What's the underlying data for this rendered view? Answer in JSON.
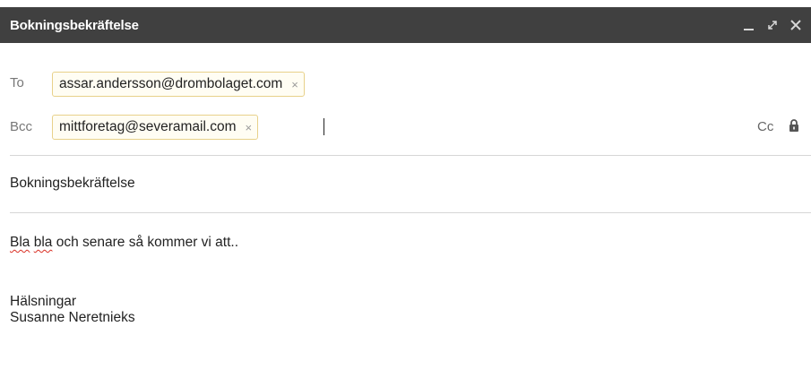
{
  "window": {
    "title": "Bokningsbekräftelse",
    "controls": [
      "minimize",
      "expand",
      "close"
    ]
  },
  "recipients": {
    "to": {
      "label": "To",
      "chips": [
        "assar.andersson@drombolaget.com"
      ]
    },
    "bcc": {
      "label": "Bcc",
      "chips": [
        "mittforetag@severamail.com"
      ]
    },
    "cc_link": "Cc"
  },
  "subject": "Bokningsbekräftelse",
  "body": {
    "line1_misspelled_1": "Bla",
    "line1_misspelled_2": "bla",
    "line1_rest": " och senare så kommer vi att..",
    "signoff": "Hälsningar",
    "signature": "Susanne Neretnieks"
  },
  "icons": {
    "chip_remove": "×",
    "lock": "lock-icon"
  },
  "colors": {
    "titlebar": "#404040",
    "chip_border": "#e8d18a",
    "chip_bg": "#fffdf3",
    "spell_underline": "#d93025"
  }
}
